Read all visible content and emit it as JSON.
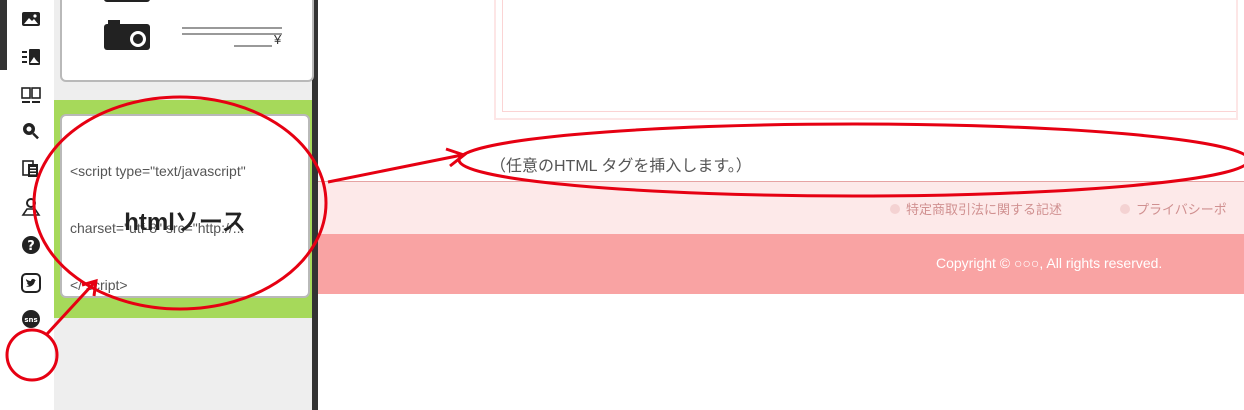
{
  "toolbar": {
    "icons": [
      "image-icon",
      "photo-list-icon",
      "columns-icon",
      "search-zoom-icon",
      "document-icon",
      "map-pin-icon",
      "help-icon",
      "twitter-icon",
      "sns-icon"
    ],
    "sns_label": "sns"
  },
  "panel": {
    "product_price_symbol": "¥",
    "html_widget": {
      "code_lines": [
        "<script type=\"text/javascript\"",
        "charset=\"utf-8\" src=\"http://...",
        "</ script>"
      ],
      "label": "htmlソース"
    }
  },
  "preview": {
    "insert_text": "（任意のHTML タグを挿入します。）",
    "links": [
      "特定商取引法に関する記述",
      "プライバシーポ"
    ],
    "copyright": "Copyright © ○○○, All rights reserved."
  },
  "colors": {
    "annotation": "#e60012",
    "footer": "#f9a3a3",
    "links_bar": "#fde9e9",
    "widget_highlight": "#a6d95a"
  }
}
